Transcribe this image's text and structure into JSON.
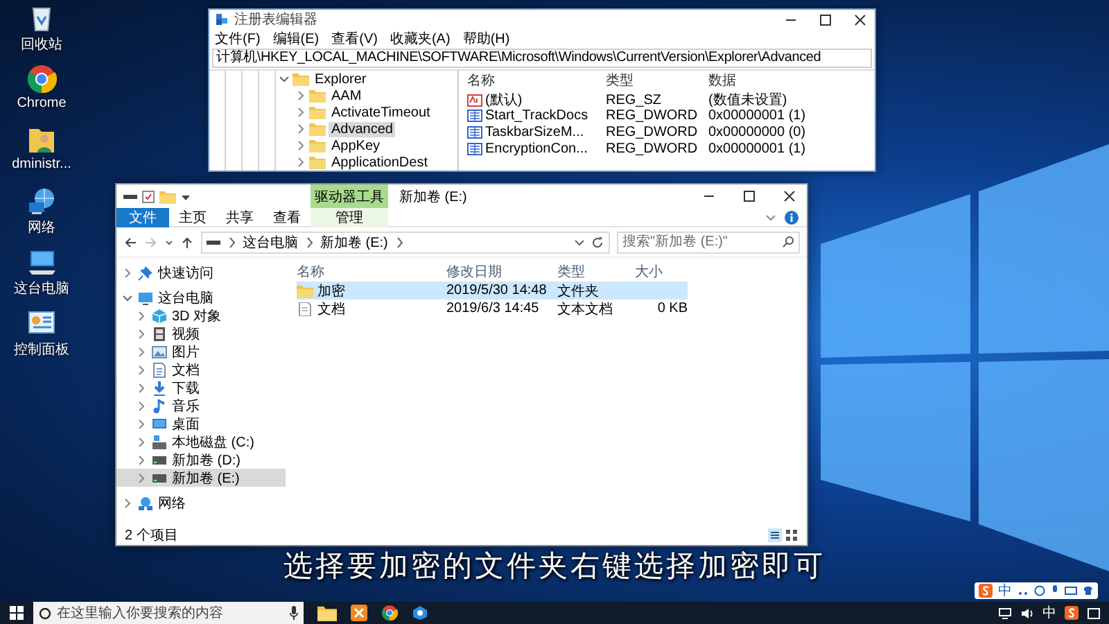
{
  "desktop_icons": [
    {
      "kind": "recycle-bin",
      "label": "回收站"
    },
    {
      "kind": "chrome",
      "label": "Chrome"
    },
    {
      "kind": "user-folder",
      "label": "dministr..."
    },
    {
      "kind": "network",
      "label": "网络"
    },
    {
      "kind": "computer",
      "label": "这台电脑"
    },
    {
      "kind": "control-panel",
      "label": "控制面板"
    }
  ],
  "registry_window": {
    "title": "注册表编辑器",
    "menu": [
      "文件(F)",
      "编辑(E)",
      "查看(V)",
      "收藏夹(A)",
      "帮助(H)"
    ],
    "address": "计算机\\HKEY_LOCAL_MACHINE\\SOFTWARE\\Microsoft\\Windows\\CurrentVersion\\Explorer\\Advanced",
    "tree": [
      {
        "label": "Explorer",
        "expanded": true,
        "selected": false,
        "children": [
          {
            "label": "AAM",
            "expanded": false,
            "selected": false
          },
          {
            "label": "ActivateTimeout",
            "expanded": false,
            "selected": false
          },
          {
            "label": "Advanced",
            "expanded": false,
            "selected": true
          },
          {
            "label": "AppKey",
            "expanded": false,
            "selected": false
          },
          {
            "label": "ApplicationDest",
            "expanded": false,
            "selected": false
          }
        ]
      }
    ],
    "columns": [
      "名称",
      "类型",
      "数据"
    ],
    "values": [
      {
        "kind": "string",
        "name": "(默认)",
        "type": "REG_SZ",
        "data": "(数值未设置)"
      },
      {
        "kind": "dword",
        "name": "Start_TrackDocs",
        "type": "REG_DWORD",
        "data": "0x00000001 (1)"
      },
      {
        "kind": "dword",
        "name": "TaskbarSizeM...",
        "type": "REG_DWORD",
        "data": "0x00000000 (0)"
      },
      {
        "kind": "dword",
        "name": "EncryptionCon...",
        "type": "REG_DWORD",
        "data": "0x00000001 (1)"
      }
    ]
  },
  "explorer_window": {
    "title": "新加卷 (E:)",
    "context_group": "驱动器工具",
    "ribbon_tabs": [
      {
        "kind": "file",
        "label": "文件"
      },
      {
        "kind": "tab",
        "label": "主页"
      },
      {
        "kind": "tab",
        "label": "共享"
      },
      {
        "kind": "tab",
        "label": "查看"
      },
      {
        "kind": "context",
        "label": "管理"
      }
    ],
    "breadcrumb": [
      "这台电脑",
      "新加卷 (E:)"
    ],
    "search": {
      "placeholder": "搜索\"新加卷 (E:)\""
    },
    "sidebar": [
      {
        "kind": "quick-access",
        "label": "快速访问",
        "expanded": false,
        "selected": false
      },
      {
        "kind": "computer",
        "label": "这台电脑",
        "expanded": true,
        "selected": false,
        "children": [
          {
            "kind": "objects",
            "label": "3D 对象",
            "expanded": false,
            "selected": false
          },
          {
            "kind": "video",
            "label": "视频",
            "expanded": false,
            "selected": false
          },
          {
            "kind": "pictures",
            "label": "图片",
            "expanded": false,
            "selected": false
          },
          {
            "kind": "documents",
            "label": "文档",
            "expanded": false,
            "selected": false
          },
          {
            "kind": "downloads",
            "label": "下载",
            "expanded": false,
            "selected": false
          },
          {
            "kind": "music",
            "label": "音乐",
            "expanded": false,
            "selected": false
          },
          {
            "kind": "desktop",
            "label": "桌面",
            "expanded": false,
            "selected": false
          },
          {
            "kind": "system-drive",
            "label": "本地磁盘 (C:)",
            "expanded": false,
            "selected": false
          },
          {
            "kind": "drive",
            "label": "新加卷 (D:)",
            "expanded": false,
            "selected": false
          },
          {
            "kind": "drive",
            "label": "新加卷 (E:)",
            "expanded": false,
            "selected": true
          }
        ]
      },
      {
        "kind": "network",
        "label": "网络",
        "expanded": false,
        "selected": false
      }
    ],
    "columns": [
      "名称",
      "修改日期",
      "类型",
      "大小"
    ],
    "files": [
      {
        "kind": "folder",
        "name": "加密",
        "modified": "2019/5/30 14:48",
        "type": "文件夹",
        "selected": true
      },
      {
        "kind": "text",
        "name": "文档",
        "modified": "2019/6/3 14:45",
        "type": "文本文档",
        "size": "0 KB",
        "selected": false
      }
    ],
    "status": "2 个项目"
  },
  "subtitle": "选择要加密的文件夹右键选择加密即可",
  "ime_bar": {
    "mode": "中"
  },
  "taskbar": {
    "search": {
      "placeholder": "在这里输入你要搜索的内容"
    },
    "input_mode": "中"
  }
}
